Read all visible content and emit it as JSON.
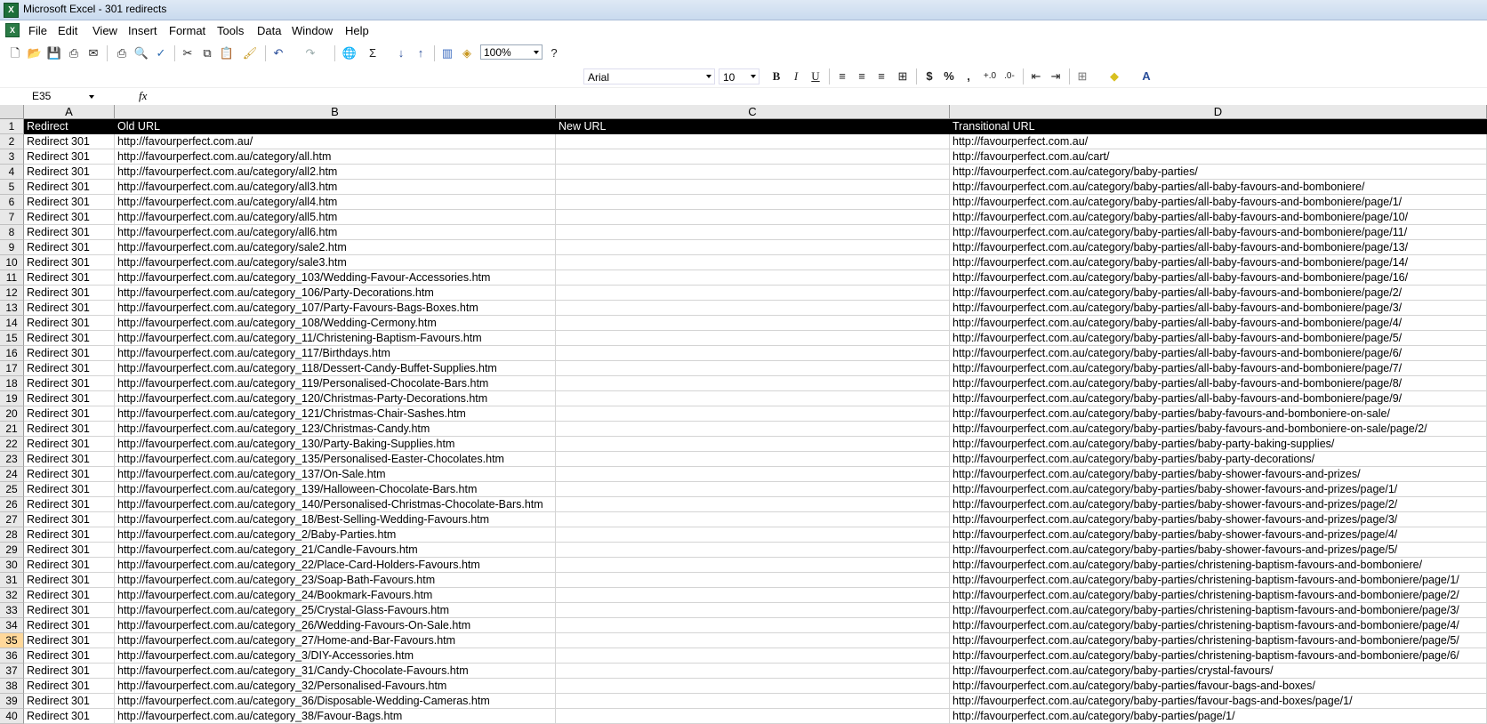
{
  "window": {
    "title": "Microsoft Excel - 301 redirects"
  },
  "menu": [
    "File",
    "Edit",
    "View",
    "Insert",
    "Format",
    "Tools",
    "Data",
    "Window",
    "Help"
  ],
  "toolbar": {
    "zoom": "100%",
    "font": "Arial",
    "size": "10",
    "bold": "B",
    "italic": "I",
    "underline": "U",
    "currency": "$",
    "percent": "%",
    "comma": ","
  },
  "formula": {
    "cell_ref": "E35",
    "fx": "fx",
    "content": ""
  },
  "columns": [
    "A",
    "B",
    "C",
    "D"
  ],
  "headers": [
    "Redirect",
    "Old URL",
    "New URL",
    "Transitional URL"
  ],
  "active_row": "35",
  "rows": [
    {
      "n": "2",
      "a": "Redirect 301",
      "b": "http://favourperfect.com.au/",
      "d": "http://favourperfect.com.au/"
    },
    {
      "n": "3",
      "a": "Redirect 301",
      "b": "http://favourperfect.com.au/category/all.htm",
      "d": "http://favourperfect.com.au/cart/"
    },
    {
      "n": "4",
      "a": "Redirect 301",
      "b": "http://favourperfect.com.au/category/all2.htm",
      "d": "http://favourperfect.com.au/category/baby-parties/"
    },
    {
      "n": "5",
      "a": "Redirect 301",
      "b": "http://favourperfect.com.au/category/all3.htm",
      "d": "http://favourperfect.com.au/category/baby-parties/all-baby-favours-and-bomboniere/"
    },
    {
      "n": "6",
      "a": "Redirect 301",
      "b": "http://favourperfect.com.au/category/all4.htm",
      "d": "http://favourperfect.com.au/category/baby-parties/all-baby-favours-and-bomboniere/page/1/"
    },
    {
      "n": "7",
      "a": "Redirect 301",
      "b": "http://favourperfect.com.au/category/all5.htm",
      "d": "http://favourperfect.com.au/category/baby-parties/all-baby-favours-and-bomboniere/page/10/"
    },
    {
      "n": "8",
      "a": "Redirect 301",
      "b": "http://favourperfect.com.au/category/all6.htm",
      "d": "http://favourperfect.com.au/category/baby-parties/all-baby-favours-and-bomboniere/page/11/"
    },
    {
      "n": "9",
      "a": "Redirect 301",
      "b": "http://favourperfect.com.au/category/sale2.htm",
      "d": "http://favourperfect.com.au/category/baby-parties/all-baby-favours-and-bomboniere/page/13/"
    },
    {
      "n": "10",
      "a": "Redirect 301",
      "b": "http://favourperfect.com.au/category/sale3.htm",
      "d": "http://favourperfect.com.au/category/baby-parties/all-baby-favours-and-bomboniere/page/14/"
    },
    {
      "n": "11",
      "a": "Redirect 301",
      "b": "http://favourperfect.com.au/category_103/Wedding-Favour-Accessories.htm",
      "d": "http://favourperfect.com.au/category/baby-parties/all-baby-favours-and-bomboniere/page/16/"
    },
    {
      "n": "12",
      "a": "Redirect 301",
      "b": "http://favourperfect.com.au/category_106/Party-Decorations.htm",
      "d": "http://favourperfect.com.au/category/baby-parties/all-baby-favours-and-bomboniere/page/2/"
    },
    {
      "n": "13",
      "a": "Redirect 301",
      "b": "http://favourperfect.com.au/category_107/Party-Favours-Bags-Boxes.htm",
      "d": "http://favourperfect.com.au/category/baby-parties/all-baby-favours-and-bomboniere/page/3/"
    },
    {
      "n": "14",
      "a": "Redirect 301",
      "b": "http://favourperfect.com.au/category_108/Wedding-Cermony.htm",
      "d": "http://favourperfect.com.au/category/baby-parties/all-baby-favours-and-bomboniere/page/4/"
    },
    {
      "n": "15",
      "a": "Redirect 301",
      "b": "http://favourperfect.com.au/category_11/Christening-Baptism-Favours.htm",
      "d": "http://favourperfect.com.au/category/baby-parties/all-baby-favours-and-bomboniere/page/5/"
    },
    {
      "n": "16",
      "a": "Redirect 301",
      "b": "http://favourperfect.com.au/category_117/Birthdays.htm",
      "d": "http://favourperfect.com.au/category/baby-parties/all-baby-favours-and-bomboniere/page/6/"
    },
    {
      "n": "17",
      "a": "Redirect 301",
      "b": "http://favourperfect.com.au/category_118/Dessert-Candy-Buffet-Supplies.htm",
      "d": "http://favourperfect.com.au/category/baby-parties/all-baby-favours-and-bomboniere/page/7/"
    },
    {
      "n": "18",
      "a": "Redirect 301",
      "b": "http://favourperfect.com.au/category_119/Personalised-Chocolate-Bars.htm",
      "d": "http://favourperfect.com.au/category/baby-parties/all-baby-favours-and-bomboniere/page/8/"
    },
    {
      "n": "19",
      "a": "Redirect 301",
      "b": "http://favourperfect.com.au/category_120/Christmas-Party-Decorations.htm",
      "d": "http://favourperfect.com.au/category/baby-parties/all-baby-favours-and-bomboniere/page/9/"
    },
    {
      "n": "20",
      "a": "Redirect 301",
      "b": "http://favourperfect.com.au/category_121/Christmas-Chair-Sashes.htm",
      "d": "http://favourperfect.com.au/category/baby-parties/baby-favours-and-bomboniere-on-sale/"
    },
    {
      "n": "21",
      "a": "Redirect 301",
      "b": "http://favourperfect.com.au/category_123/Christmas-Candy.htm",
      "d": "http://favourperfect.com.au/category/baby-parties/baby-favours-and-bomboniere-on-sale/page/2/"
    },
    {
      "n": "22",
      "a": "Redirect 301",
      "b": "http://favourperfect.com.au/category_130/Party-Baking-Supplies.htm",
      "d": "http://favourperfect.com.au/category/baby-parties/baby-party-baking-supplies/"
    },
    {
      "n": "23",
      "a": "Redirect 301",
      "b": "http://favourperfect.com.au/category_135/Personalised-Easter-Chocolates.htm",
      "d": "http://favourperfect.com.au/category/baby-parties/baby-party-decorations/"
    },
    {
      "n": "24",
      "a": "Redirect 301",
      "b": "http://favourperfect.com.au/category_137/On-Sale.htm",
      "d": "http://favourperfect.com.au/category/baby-parties/baby-shower-favours-and-prizes/"
    },
    {
      "n": "25",
      "a": "Redirect 301",
      "b": "http://favourperfect.com.au/category_139/Halloween-Chocolate-Bars.htm",
      "d": "http://favourperfect.com.au/category/baby-parties/baby-shower-favours-and-prizes/page/1/"
    },
    {
      "n": "26",
      "a": "Redirect 301",
      "b": "http://favourperfect.com.au/category_140/Personalised-Christmas-Chocolate-Bars.htm",
      "d": "http://favourperfect.com.au/category/baby-parties/baby-shower-favours-and-prizes/page/2/"
    },
    {
      "n": "27",
      "a": "Redirect 301",
      "b": "http://favourperfect.com.au/category_18/Best-Selling-Wedding-Favours.htm",
      "d": "http://favourperfect.com.au/category/baby-parties/baby-shower-favours-and-prizes/page/3/"
    },
    {
      "n": "28",
      "a": "Redirect 301",
      "b": "http://favourperfect.com.au/category_2/Baby-Parties.htm",
      "d": "http://favourperfect.com.au/category/baby-parties/baby-shower-favours-and-prizes/page/4/"
    },
    {
      "n": "29",
      "a": "Redirect 301",
      "b": "http://favourperfect.com.au/category_21/Candle-Favours.htm",
      "d": "http://favourperfect.com.au/category/baby-parties/baby-shower-favours-and-prizes/page/5/"
    },
    {
      "n": "30",
      "a": "Redirect 301",
      "b": "http://favourperfect.com.au/category_22/Place-Card-Holders-Favours.htm",
      "d": "http://favourperfect.com.au/category/baby-parties/christening-baptism-favours-and-bomboniere/"
    },
    {
      "n": "31",
      "a": "Redirect 301",
      "b": "http://favourperfect.com.au/category_23/Soap-Bath-Favours.htm",
      "d": "http://favourperfect.com.au/category/baby-parties/christening-baptism-favours-and-bomboniere/page/1/"
    },
    {
      "n": "32",
      "a": "Redirect 301",
      "b": "http://favourperfect.com.au/category_24/Bookmark-Favours.htm",
      "d": "http://favourperfect.com.au/category/baby-parties/christening-baptism-favours-and-bomboniere/page/2/"
    },
    {
      "n": "33",
      "a": "Redirect 301",
      "b": "http://favourperfect.com.au/category_25/Crystal-Glass-Favours.htm",
      "d": "http://favourperfect.com.au/category/baby-parties/christening-baptism-favours-and-bomboniere/page/3/"
    },
    {
      "n": "34",
      "a": "Redirect 301",
      "b": "http://favourperfect.com.au/category_26/Wedding-Favours-On-Sale.htm",
      "d": "http://favourperfect.com.au/category/baby-parties/christening-baptism-favours-and-bomboniere/page/4/"
    },
    {
      "n": "35",
      "a": "Redirect 301",
      "b": "http://favourperfect.com.au/category_27/Home-and-Bar-Favours.htm",
      "d": "http://favourperfect.com.au/category/baby-parties/christening-baptism-favours-and-bomboniere/page/5/"
    },
    {
      "n": "36",
      "a": "Redirect 301",
      "b": "http://favourperfect.com.au/category_3/DIY-Accessories.htm",
      "d": "http://favourperfect.com.au/category/baby-parties/christening-baptism-favours-and-bomboniere/page/6/"
    },
    {
      "n": "37",
      "a": "Redirect 301",
      "b": "http://favourperfect.com.au/category_31/Candy-Chocolate-Favours.htm",
      "d": "http://favourperfect.com.au/category/baby-parties/crystal-favours/"
    },
    {
      "n": "38",
      "a": "Redirect 301",
      "b": "http://favourperfect.com.au/category_32/Personalised-Favours.htm",
      "d": "http://favourperfect.com.au/category/baby-parties/favour-bags-and-boxes/"
    },
    {
      "n": "39",
      "a": "Redirect 301",
      "b": "http://favourperfect.com.au/category_36/Disposable-Wedding-Cameras.htm",
      "d": "http://favourperfect.com.au/category/baby-parties/favour-bags-and-boxes/page/1/"
    },
    {
      "n": "40",
      "a": "Redirect 301",
      "b": "http://favourperfect.com.au/category_38/Favour-Bags.htm",
      "d": "http://favourperfect.com.au/category/baby-parties/page/1/"
    }
  ]
}
